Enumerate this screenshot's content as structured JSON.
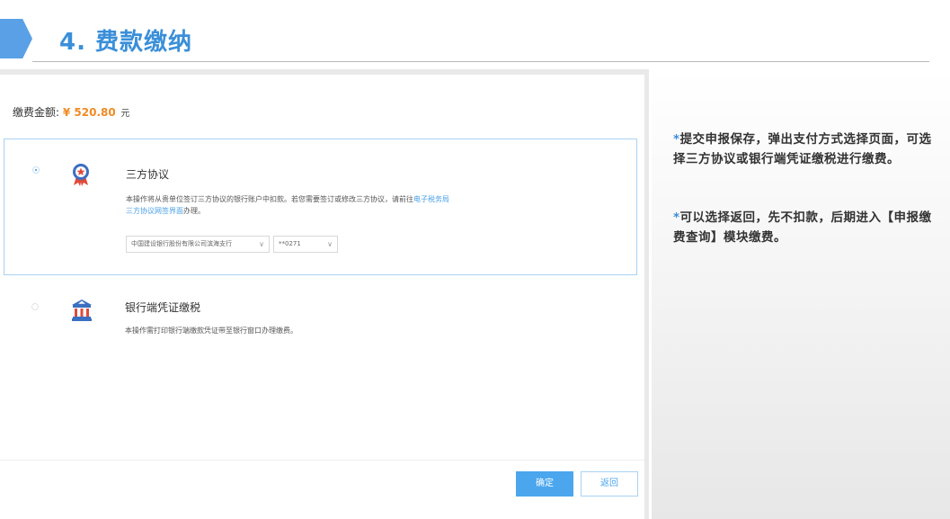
{
  "header": {
    "title": "4. 费款缴纳"
  },
  "payment": {
    "amount_label": "缴费金额:",
    "amount_value": "¥ 520.80",
    "amount_unit": "元"
  },
  "options": [
    {
      "title": "三方协议",
      "selected": true,
      "icon": "ribbon-badge-icon",
      "desc_text": "本操作将从贵单位签订三方协议的银行账户中扣款。若您需要签订或修改三方协议，请前往",
      "desc_link": "电子税务局三方协议网签界面",
      "desc_tail": "办理。",
      "bank_select": "中国建设银行股份有限公司滨海支行",
      "account_select": "**0271"
    },
    {
      "title": "银行端凭证缴税",
      "selected": false,
      "icon": "bank-building-icon",
      "desc_text": "本操作需打印银行端缴款凭证带至银行窗口办理缴费。"
    }
  ],
  "buttons": {
    "confirm": "确定",
    "back": "返回"
  },
  "notes": [
    {
      "star": "*",
      "text": "提交申报保存，弹出支付方式选择页面，可选择三方协议或银行端凭证缴税进行缴费。"
    },
    {
      "star": "*",
      "text": "可以选择返回，先不扣款，后期进入【申报缴费查询】模块缴费。"
    }
  ],
  "colors": {
    "accent": "#3a8fd9",
    "amount": "#f08a24",
    "icon_red": "#e04a3a",
    "icon_blue": "#3b6fc2"
  }
}
